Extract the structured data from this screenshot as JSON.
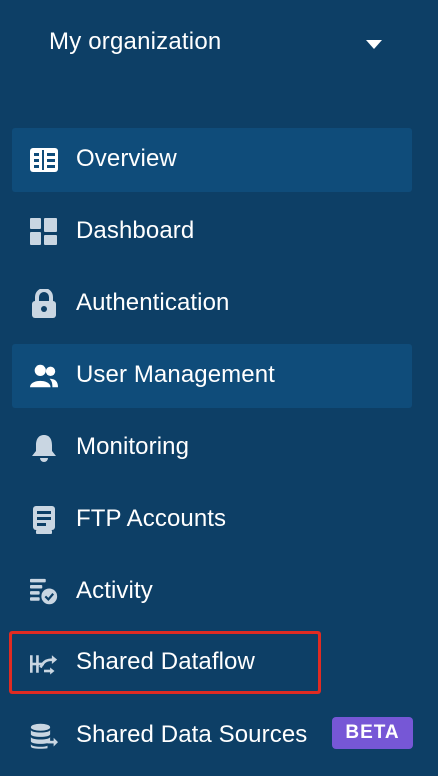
{
  "org": {
    "name": "My organization",
    "caret_icon": "caret-down-icon"
  },
  "nav": {
    "items": [
      {
        "label": "Overview",
        "icon": "overview-icon",
        "state": "highlighted"
      },
      {
        "label": "Dashboard",
        "icon": "dashboard-icon"
      },
      {
        "label": "Authentication",
        "icon": "lock-icon"
      },
      {
        "label": "User Management",
        "icon": "users-icon",
        "state": "highlighted"
      },
      {
        "label": "Monitoring",
        "icon": "bell-icon"
      },
      {
        "label": "FTP Accounts",
        "icon": "ftp-account-icon"
      },
      {
        "label": "Activity",
        "icon": "activity-icon"
      },
      {
        "label": "Shared Dataflow",
        "icon": "dataflow-icon",
        "state": "outlined"
      },
      {
        "label": "Shared Data Sources",
        "icon": "database-icon",
        "badge": "BETA"
      }
    ]
  },
  "colors": {
    "background": "#0d3f66",
    "highlight": "#0f4c7a",
    "icon": "#c9d6e2",
    "outline": "#e02b22",
    "badge": "#7657d6"
  }
}
